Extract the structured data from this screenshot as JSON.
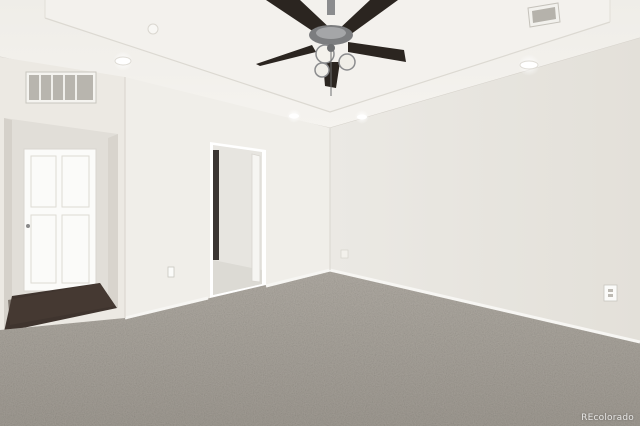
{
  "photo": {
    "subject": "empty-bedroom",
    "features": [
      "tray-ceiling",
      "ceiling-fan",
      "recessed-lights",
      "carpet",
      "closet-door",
      "bathroom-doorway",
      "air-vents",
      "wall-outlets"
    ]
  },
  "watermark": {
    "text": "REcolorado"
  },
  "colors": {
    "ceiling": "#f1efea",
    "wall_left": "#efede8",
    "wall_right": "#e6e3dc",
    "carpet": "#a8a39b",
    "wood_floor": "#3f342e",
    "fan_metal": "#7c7d7f",
    "fan_blade": "#2b2520"
  }
}
